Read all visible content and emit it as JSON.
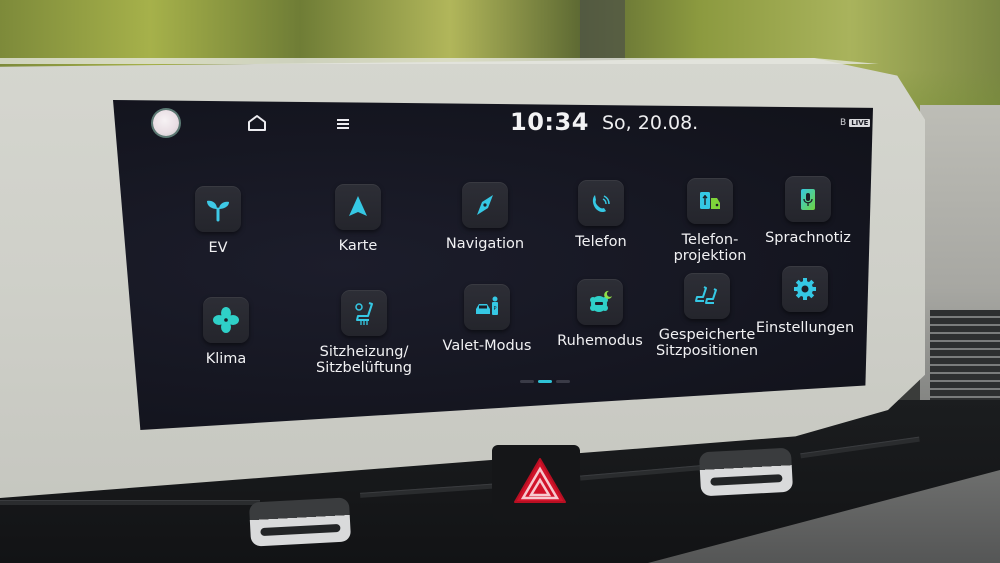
{
  "status_bar": {
    "time": "10:34",
    "date": "So, 20.08.",
    "home_icon": "home-icon",
    "menu_icon": "menu-icon",
    "profile_icon": "profile-circle-icon",
    "bluetooth_indicator": "B",
    "live_badge": "LIVE"
  },
  "apps": [
    {
      "label": "EV",
      "icon": "sprout-icon"
    },
    {
      "label": "Karte",
      "icon": "map-arrow-icon"
    },
    {
      "label": "Navigation",
      "icon": "compass-icon"
    },
    {
      "label": "Telefon",
      "icon": "phone-icon"
    },
    {
      "label": "Telefon-\nprojektion",
      "label_lines": [
        "Telefon-",
        "projektion"
      ],
      "icon": "phone-projection-icon"
    },
    {
      "label": "Sprachnotiz",
      "icon": "voice-memo-icon"
    },
    {
      "label": "Klima",
      "icon": "fan-icon"
    },
    {
      "label_lines": [
        "Sitzheizung/",
        "Sitzbelüftung"
      ],
      "icon": "seat-heating-icon"
    },
    {
      "label": "Valet-Modus",
      "icon": "valet-icon"
    },
    {
      "label": "Ruhemodus",
      "icon": "quiet-mode-icon"
    },
    {
      "label_lines": [
        "Gespeicherte",
        "Sitzpositionen"
      ],
      "icon": "seat-memory-icon"
    },
    {
      "label": "Einstellungen",
      "icon": "gear-icon"
    }
  ],
  "pagination": {
    "pages": 3,
    "current": 2
  },
  "colors": {
    "accent": "#2fc2d6",
    "screen_bg": "#14151f",
    "hazard_red": "#d2132a"
  }
}
